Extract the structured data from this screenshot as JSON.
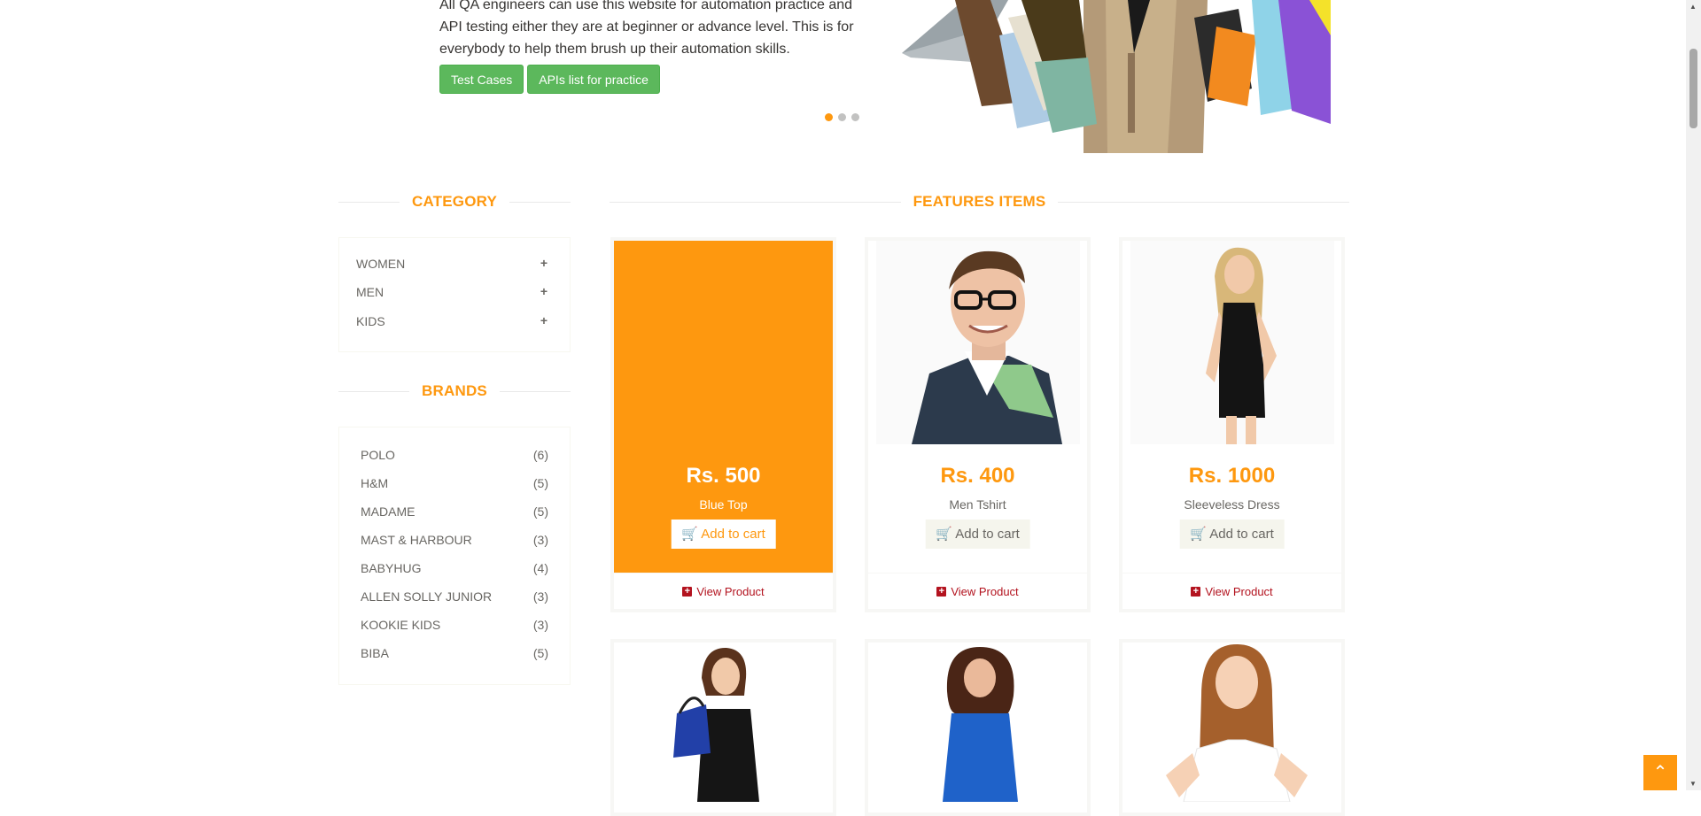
{
  "hero": {
    "text": "All QA engineers can use this website for automation practice and API testing either they are at beginner or advance level. This is for everybody to help them brush up their automation skills.",
    "buttons": [
      "Test Cases",
      "APIs list for practice"
    ],
    "arrow_left": "‹",
    "arrow_right": "›"
  },
  "category": {
    "title": "CATEGORY",
    "items": [
      {
        "label": "WOMEN",
        "icon": "+"
      },
      {
        "label": "MEN",
        "icon": "+"
      },
      {
        "label": "KIDS",
        "icon": "+"
      }
    ]
  },
  "brands": {
    "title": "BRANDS",
    "items": [
      {
        "name": "POLO",
        "count": "(6)"
      },
      {
        "name": "H&M",
        "count": "(5)"
      },
      {
        "name": "MADAME",
        "count": "(5)"
      },
      {
        "name": "MAST & HARBOUR",
        "count": "(3)"
      },
      {
        "name": "BABYHUG",
        "count": "(4)"
      },
      {
        "name": "ALLEN SOLLY JUNIOR",
        "count": "(3)"
      },
      {
        "name": "KOOKIE KIDS",
        "count": "(3)"
      },
      {
        "name": "BIBA",
        "count": "(5)"
      }
    ]
  },
  "features": {
    "title": "FEATURES ITEMS",
    "products": [
      {
        "price": "Rs. 500",
        "name": "Blue Top",
        "add_label": "Add to cart",
        "view_label": "View Product"
      },
      {
        "price": "Rs. 400",
        "name": "Men Tshirt",
        "add_label": "Add to cart",
        "view_label": "View Product"
      },
      {
        "price": "Rs. 1000",
        "name": "Sleeveless Dress",
        "add_label": "Add to cart",
        "view_label": "View Product"
      }
    ]
  },
  "colors": {
    "accent": "#fe980f",
    "button_green": "#5cb85c",
    "view_product_red": "#b3131f"
  },
  "icons": {
    "cart": "cart-icon",
    "view": "plus-square-icon",
    "scroll_up": "chevron-up-icon"
  }
}
